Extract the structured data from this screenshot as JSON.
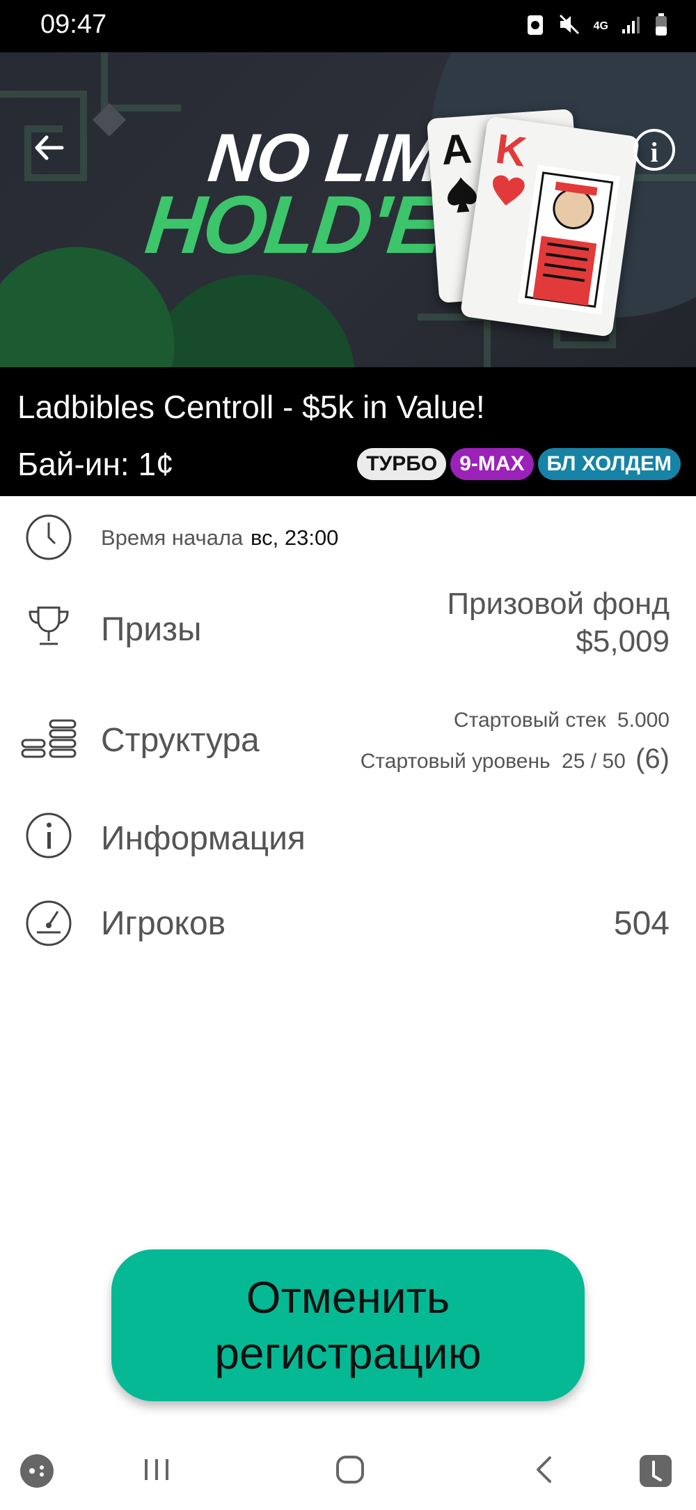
{
  "status_bar": {
    "time": "09:47",
    "network": "4G"
  },
  "tournament": {
    "banner_line1": "NO LIMIT",
    "banner_line2": "HOLD'EM",
    "card_a_rank": "A",
    "card_k_rank": "K",
    "name": "Ladbibles Centroll - $5k in Value!",
    "buyin": "Бай-ин: 1¢",
    "badges": [
      {
        "label": "ТУРБО",
        "color": "#ebebeb"
      },
      {
        "label": "9-MAX",
        "color": "#9b22b8"
      },
      {
        "label": "БЛ ХОЛДЕМ",
        "color": "#1783a6"
      }
    ]
  },
  "details": {
    "start_time_label": "Время начала",
    "start_time_value": "вс, 23:00",
    "prizes_label": "Призы",
    "prize_pool_label": "Призовой фонд",
    "prize_pool_value": "$5,009",
    "structure_label": "Структура",
    "starting_stack_label": "Стартовый стек",
    "starting_stack_value": "5.000",
    "starting_level_label": "Стартовый уровень",
    "starting_level_value": "25 / 50",
    "starting_level_extra": "(6)",
    "info_label": "Информация",
    "players_label": "Игроков",
    "players_value": "504"
  },
  "actions": {
    "unregister": "Отменить регистрацию"
  },
  "colors": {
    "accent": "#05b995",
    "banner_green": "#3cc56a"
  },
  "icons": [
    "back-arrow-icon",
    "info-icon",
    "clock-icon",
    "trophy-icon",
    "structure-icon",
    "info-circle-icon",
    "gauge-icon",
    "game-launcher-icon",
    "recent-apps-icon",
    "home-icon",
    "back-icon",
    "assistant-icon"
  ]
}
